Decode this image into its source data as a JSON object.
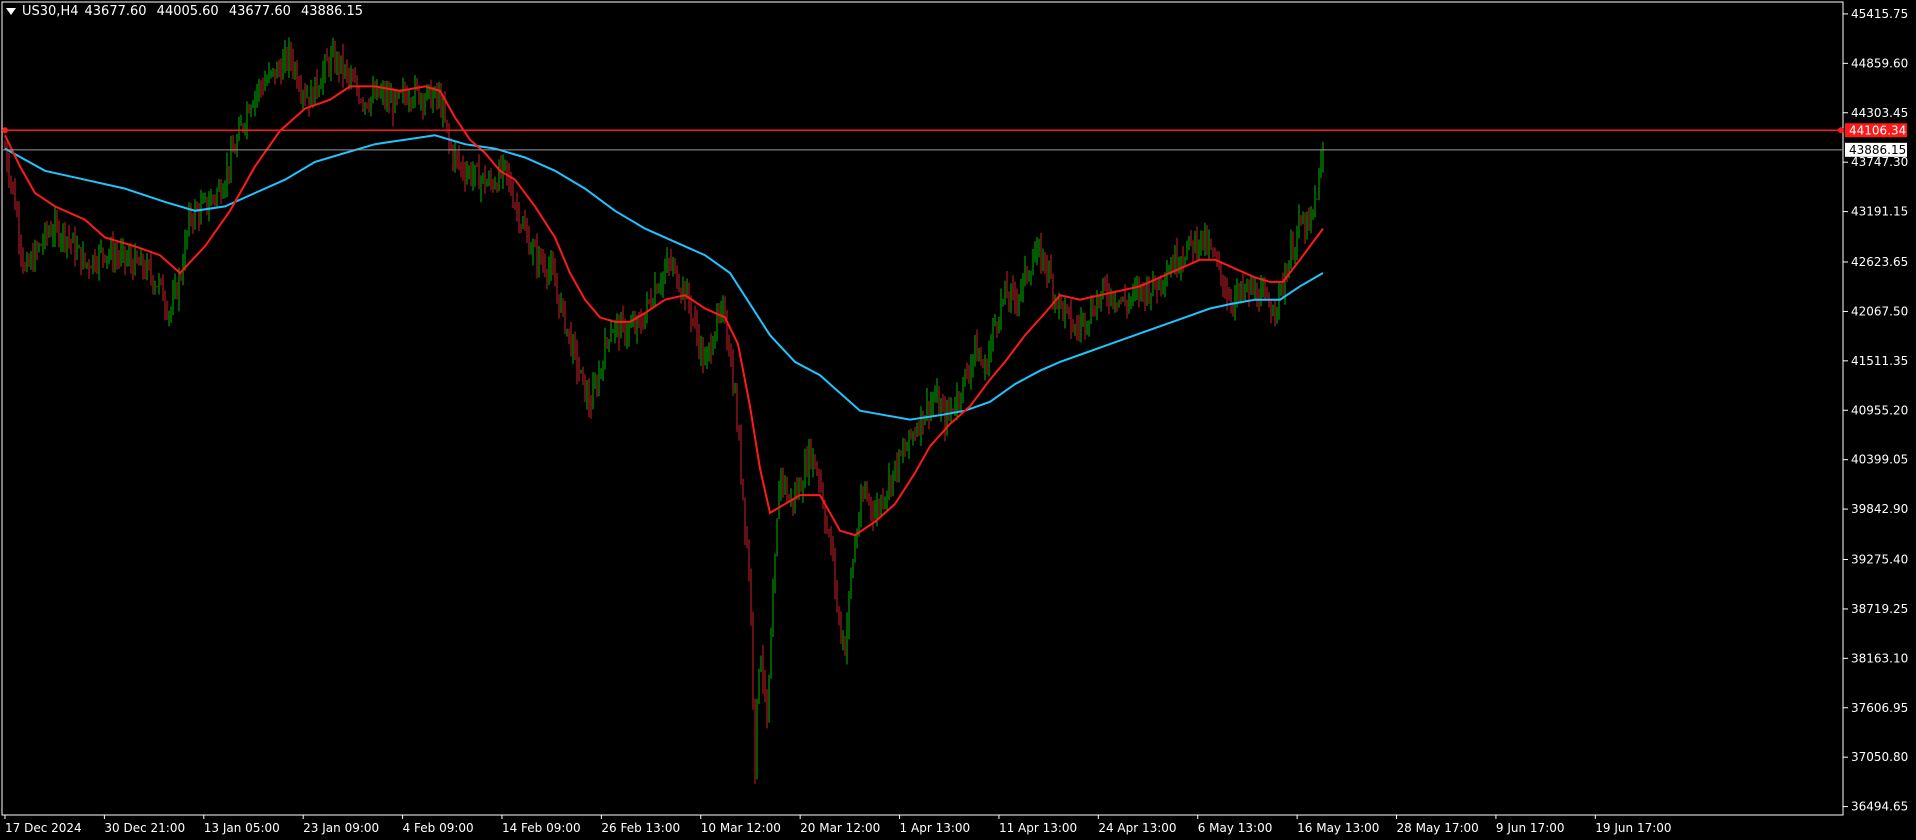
{
  "header": {
    "symbol": "US30,H4",
    "open": "43677.60",
    "high": "44005.60",
    "low": "43677.60",
    "close": "43886.15"
  },
  "colors": {
    "background": "#000000",
    "bull": "#00b300",
    "bear": "#cc1f2a",
    "ma_fast": "#ff1a1a",
    "ma_slow": "#22c4ff",
    "hline": "#ff1a1a",
    "bid_line": "#9a9a9a",
    "axis": "#ffffff"
  },
  "chart_data": {
    "type": "candlestick",
    "timeframe": "H4",
    "y_ticks": [
      "45415.75",
      "44859.60",
      "44303.45",
      "43747.30",
      "43191.15",
      "42623.65",
      "42067.50",
      "41511.35",
      "40955.20",
      "40399.05",
      "39842.90",
      "39275.40",
      "38719.25",
      "38163.10",
      "37606.95",
      "37050.80",
      "36494.65"
    ],
    "ylim": [
      36400,
      45550
    ],
    "x_ticks": [
      "17 Dec 2024",
      "30 Dec 21:00",
      "13 Jan 05:00",
      "23 Jan 09:00",
      "4 Feb 09:00",
      "14 Feb 09:00",
      "26 Feb 13:00",
      "10 Mar 12:00",
      "20 Mar 12:00",
      "1 Apr 13:00",
      "11 Apr 13:00",
      "24 Apr 13:00",
      "6 May 13:00",
      "16 May 13:00",
      "28 May 17:00",
      "9 Jun 17:00",
      "19 Jun 17:00"
    ],
    "price_path": [
      [
        0,
        43900
      ],
      [
        10,
        43300
      ],
      [
        20,
        42500
      ],
      [
        30,
        42700
      ],
      [
        45,
        43000
      ],
      [
        60,
        42950
      ],
      [
        80,
        42600
      ],
      [
        100,
        42750
      ],
      [
        120,
        42650
      ],
      [
        140,
        42550
      ],
      [
        155,
        42350
      ],
      [
        165,
        42050
      ],
      [
        175,
        42450
      ],
      [
        185,
        43150
      ],
      [
        200,
        43250
      ],
      [
        215,
        43450
      ],
      [
        230,
        43900
      ],
      [
        245,
        44450
      ],
      [
        255,
        44600
      ],
      [
        265,
        44700
      ],
      [
        275,
        44800
      ],
      [
        285,
        44950
      ],
      [
        295,
        44650
      ],
      [
        305,
        44450
      ],
      [
        315,
        44700
      ],
      [
        325,
        44900
      ],
      [
        335,
        44850
      ],
      [
        345,
        44650
      ],
      [
        360,
        44450
      ],
      [
        375,
        44500
      ],
      [
        390,
        44400
      ],
      [
        405,
        44550
      ],
      [
        420,
        44500
      ],
      [
        435,
        44450
      ],
      [
        445,
        43900
      ],
      [
        455,
        43700
      ],
      [
        470,
        43600
      ],
      [
        485,
        43500
      ],
      [
        500,
        43650
      ],
      [
        510,
        43300
      ],
      [
        520,
        42950
      ],
      [
        530,
        42700
      ],
      [
        545,
        42550
      ],
      [
        555,
        42150
      ],
      [
        565,
        41750
      ],
      [
        575,
        41350
      ],
      [
        585,
        41000
      ],
      [
        595,
        41400
      ],
      [
        605,
        41900
      ],
      [
        620,
        41850
      ],
      [
        635,
        41900
      ],
      [
        650,
        42350
      ],
      [
        665,
        42600
      ],
      [
        680,
        42300
      ],
      [
        690,
        41900
      ],
      [
        700,
        41450
      ],
      [
        710,
        41900
      ],
      [
        720,
        42050
      ],
      [
        730,
        41100
      ],
      [
        738,
        40000
      ],
      [
        745,
        39000
      ],
      [
        750,
        37000
      ],
      [
        755,
        38400
      ],
      [
        762,
        37400
      ],
      [
        768,
        38800
      ],
      [
        775,
        40300
      ],
      [
        785,
        39900
      ],
      [
        795,
        40100
      ],
      [
        805,
        40500
      ],
      [
        815,
        40200
      ],
      [
        822,
        39600
      ],
      [
        828,
        39300
      ],
      [
        833,
        38600
      ],
      [
        840,
        38300
      ],
      [
        847,
        39200
      ],
      [
        853,
        39700
      ],
      [
        860,
        40050
      ],
      [
        870,
        39800
      ],
      [
        880,
        40050
      ],
      [
        890,
        40300
      ],
      [
        900,
        40500
      ],
      [
        910,
        40750
      ],
      [
        920,
        40950
      ],
      [
        930,
        41100
      ],
      [
        940,
        40850
      ],
      [
        950,
        41050
      ],
      [
        960,
        41300
      ],
      [
        970,
        41650
      ],
      [
        980,
        41400
      ],
      [
        990,
        41950
      ],
      [
        1000,
        42250
      ],
      [
        1010,
        42200
      ],
      [
        1020,
        42450
      ],
      [
        1030,
        42700
      ],
      [
        1040,
        42650
      ],
      [
        1050,
        42250
      ],
      [
        1060,
        42050
      ],
      [
        1070,
        41850
      ],
      [
        1080,
        42000
      ],
      [
        1090,
        42150
      ],
      [
        1100,
        42300
      ],
      [
        1110,
        42250
      ],
      [
        1120,
        42150
      ],
      [
        1135,
        42300
      ],
      [
        1150,
        42350
      ],
      [
        1165,
        42600
      ],
      [
        1180,
        42750
      ],
      [
        1195,
        42900
      ],
      [
        1205,
        42750
      ],
      [
        1215,
        42500
      ],
      [
        1225,
        42200
      ],
      [
        1235,
        42250
      ],
      [
        1245,
        42300
      ],
      [
        1255,
        42250
      ],
      [
        1265,
        42100
      ],
      [
        1275,
        42250
      ],
      [
        1285,
        42700
      ],
      [
        1295,
        43050
      ],
      [
        1305,
        43000
      ],
      [
        1315,
        43600
      ],
      [
        1318,
        43886
      ]
    ],
    "ma_fast": [
      [
        0,
        44050
      ],
      [
        15,
        43700
      ],
      [
        30,
        43400
      ],
      [
        50,
        43250
      ],
      [
        80,
        43100
      ],
      [
        100,
        42900
      ],
      [
        130,
        42800
      ],
      [
        155,
        42700
      ],
      [
        175,
        42500
      ],
      [
        200,
        42800
      ],
      [
        225,
        43200
      ],
      [
        250,
        43700
      ],
      [
        275,
        44100
      ],
      [
        300,
        44350
      ],
      [
        325,
        44450
      ],
      [
        345,
        44600
      ],
      [
        370,
        44600
      ],
      [
        395,
        44550
      ],
      [
        420,
        44600
      ],
      [
        435,
        44550
      ],
      [
        450,
        44250
      ],
      [
        465,
        44000
      ],
      [
        480,
        43850
      ],
      [
        495,
        43650
      ],
      [
        510,
        43550
      ],
      [
        530,
        43250
      ],
      [
        550,
        42900
      ],
      [
        565,
        42500
      ],
      [
        580,
        42200
      ],
      [
        595,
        42000
      ],
      [
        610,
        41950
      ],
      [
        625,
        41950
      ],
      [
        640,
        42050
      ],
      [
        660,
        42200
      ],
      [
        680,
        42250
      ],
      [
        700,
        42100
      ],
      [
        720,
        42000
      ],
      [
        733,
        41700
      ],
      [
        745,
        41000
      ],
      [
        755,
        40300
      ],
      [
        765,
        39800
      ],
      [
        780,
        39900
      ],
      [
        795,
        40000
      ],
      [
        815,
        40000
      ],
      [
        835,
        39600
      ],
      [
        850,
        39550
      ],
      [
        870,
        39700
      ],
      [
        890,
        39900
      ],
      [
        910,
        40250
      ],
      [
        925,
        40550
      ],
      [
        945,
        40800
      ],
      [
        965,
        41000
      ],
      [
        985,
        41300
      ],
      [
        1000,
        41500
      ],
      [
        1020,
        41800
      ],
      [
        1040,
        42050
      ],
      [
        1055,
        42250
      ],
      [
        1075,
        42200
      ],
      [
        1095,
        42250
      ],
      [
        1115,
        42300
      ],
      [
        1135,
        42350
      ],
      [
        1155,
        42450
      ],
      [
        1175,
        42550
      ],
      [
        1195,
        42650
      ],
      [
        1210,
        42650
      ],
      [
        1230,
        42550
      ],
      [
        1250,
        42450
      ],
      [
        1265,
        42400
      ],
      [
        1278,
        42400
      ],
      [
        1295,
        42650
      ],
      [
        1318,
        43000
      ]
    ],
    "ma_slow": [
      [
        0,
        43900
      ],
      [
        40,
        43650
      ],
      [
        80,
        43550
      ],
      [
        120,
        43450
      ],
      [
        160,
        43300
      ],
      [
        190,
        43200
      ],
      [
        220,
        43250
      ],
      [
        250,
        43400
      ],
      [
        280,
        43550
      ],
      [
        310,
        43750
      ],
      [
        340,
        43850
      ],
      [
        370,
        43950
      ],
      [
        400,
        44000
      ],
      [
        430,
        44050
      ],
      [
        460,
        43950
      ],
      [
        490,
        43900
      ],
      [
        520,
        43800
      ],
      [
        550,
        43650
      ],
      [
        580,
        43450
      ],
      [
        610,
        43200
      ],
      [
        640,
        43000
      ],
      [
        670,
        42850
      ],
      [
        700,
        42700
      ],
      [
        725,
        42500
      ],
      [
        745,
        42150
      ],
      [
        765,
        41800
      ],
      [
        790,
        41500
      ],
      [
        815,
        41350
      ],
      [
        835,
        41150
      ],
      [
        855,
        40950
      ],
      [
        880,
        40900
      ],
      [
        905,
        40850
      ],
      [
        935,
        40900
      ],
      [
        960,
        40950
      ],
      [
        985,
        41050
      ],
      [
        1010,
        41250
      ],
      [
        1035,
        41400
      ],
      [
        1055,
        41500
      ],
      [
        1080,
        41600
      ],
      [
        1105,
        41700
      ],
      [
        1130,
        41800
      ],
      [
        1155,
        41900
      ],
      [
        1180,
        42000
      ],
      [
        1205,
        42100
      ],
      [
        1225,
        42150
      ],
      [
        1250,
        42200
      ],
      [
        1275,
        42200
      ],
      [
        1295,
        42350
      ],
      [
        1318,
        42500
      ]
    ],
    "h_line": "44106.34",
    "bid": "43886.15"
  }
}
